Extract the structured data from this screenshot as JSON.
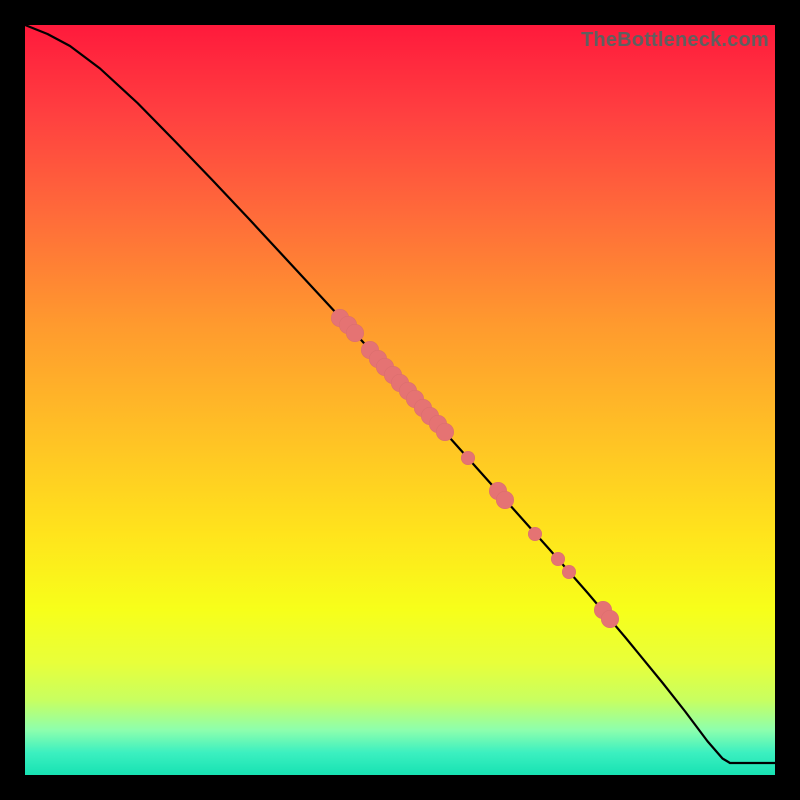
{
  "watermark": "TheBottleneck.com",
  "colors": {
    "point": "#e57373",
    "curve": "#000000"
  },
  "chart_data": {
    "type": "line",
    "title": "",
    "xlabel": "",
    "ylabel": "",
    "xlim": [
      0,
      100
    ],
    "ylim": [
      0,
      100
    ],
    "grid": false,
    "curve": [
      {
        "x": 0,
        "y": 100.0
      },
      {
        "x": 3,
        "y": 98.8
      },
      {
        "x": 6,
        "y": 97.2
      },
      {
        "x": 10,
        "y": 94.2
      },
      {
        "x": 15,
        "y": 89.6
      },
      {
        "x": 20,
        "y": 84.5
      },
      {
        "x": 25,
        "y": 79.3
      },
      {
        "x": 30,
        "y": 74.0
      },
      {
        "x": 35,
        "y": 68.6
      },
      {
        "x": 40,
        "y": 63.2
      },
      {
        "x": 45,
        "y": 57.8
      },
      {
        "x": 50,
        "y": 52.3
      },
      {
        "x": 55,
        "y": 46.8
      },
      {
        "x": 60,
        "y": 41.2
      },
      {
        "x": 65,
        "y": 35.6
      },
      {
        "x": 70,
        "y": 30.0
      },
      {
        "x": 75,
        "y": 24.3
      },
      {
        "x": 80,
        "y": 18.4
      },
      {
        "x": 85,
        "y": 12.3
      },
      {
        "x": 88,
        "y": 8.5
      },
      {
        "x": 91,
        "y": 4.5
      },
      {
        "x": 93,
        "y": 2.2
      },
      {
        "x": 94,
        "y": 1.6
      },
      {
        "x": 95,
        "y": 1.6
      },
      {
        "x": 100,
        "y": 1.6
      }
    ],
    "points": [
      {
        "x": 42.0,
        "y": 61.0,
        "r": 9
      },
      {
        "x": 43.0,
        "y": 60.0,
        "r": 9
      },
      {
        "x": 44.0,
        "y": 58.9,
        "r": 9
      },
      {
        "x": 46.0,
        "y": 56.7,
        "r": 9
      },
      {
        "x": 47.0,
        "y": 55.5,
        "r": 9
      },
      {
        "x": 48.0,
        "y": 54.4,
        "r": 9
      },
      {
        "x": 49.0,
        "y": 53.4,
        "r": 9
      },
      {
        "x": 50.0,
        "y": 52.3,
        "r": 9
      },
      {
        "x": 51.0,
        "y": 51.2,
        "r": 9
      },
      {
        "x": 52.0,
        "y": 50.1,
        "r": 9
      },
      {
        "x": 53.0,
        "y": 49.0,
        "r": 9
      },
      {
        "x": 54.0,
        "y": 47.9,
        "r": 9
      },
      {
        "x": 55.0,
        "y": 46.8,
        "r": 9
      },
      {
        "x": 56.0,
        "y": 45.7,
        "r": 9
      },
      {
        "x": 59.0,
        "y": 42.3,
        "r": 7
      },
      {
        "x": 63.0,
        "y": 37.9,
        "r": 9
      },
      {
        "x": 64.0,
        "y": 36.7,
        "r": 9
      },
      {
        "x": 68.0,
        "y": 32.2,
        "r": 7
      },
      {
        "x": 71.0,
        "y": 28.8,
        "r": 7
      },
      {
        "x": 72.5,
        "y": 27.1,
        "r": 7
      },
      {
        "x": 77.0,
        "y": 22.0,
        "r": 9
      },
      {
        "x": 78.0,
        "y": 20.8,
        "r": 9
      }
    ]
  }
}
